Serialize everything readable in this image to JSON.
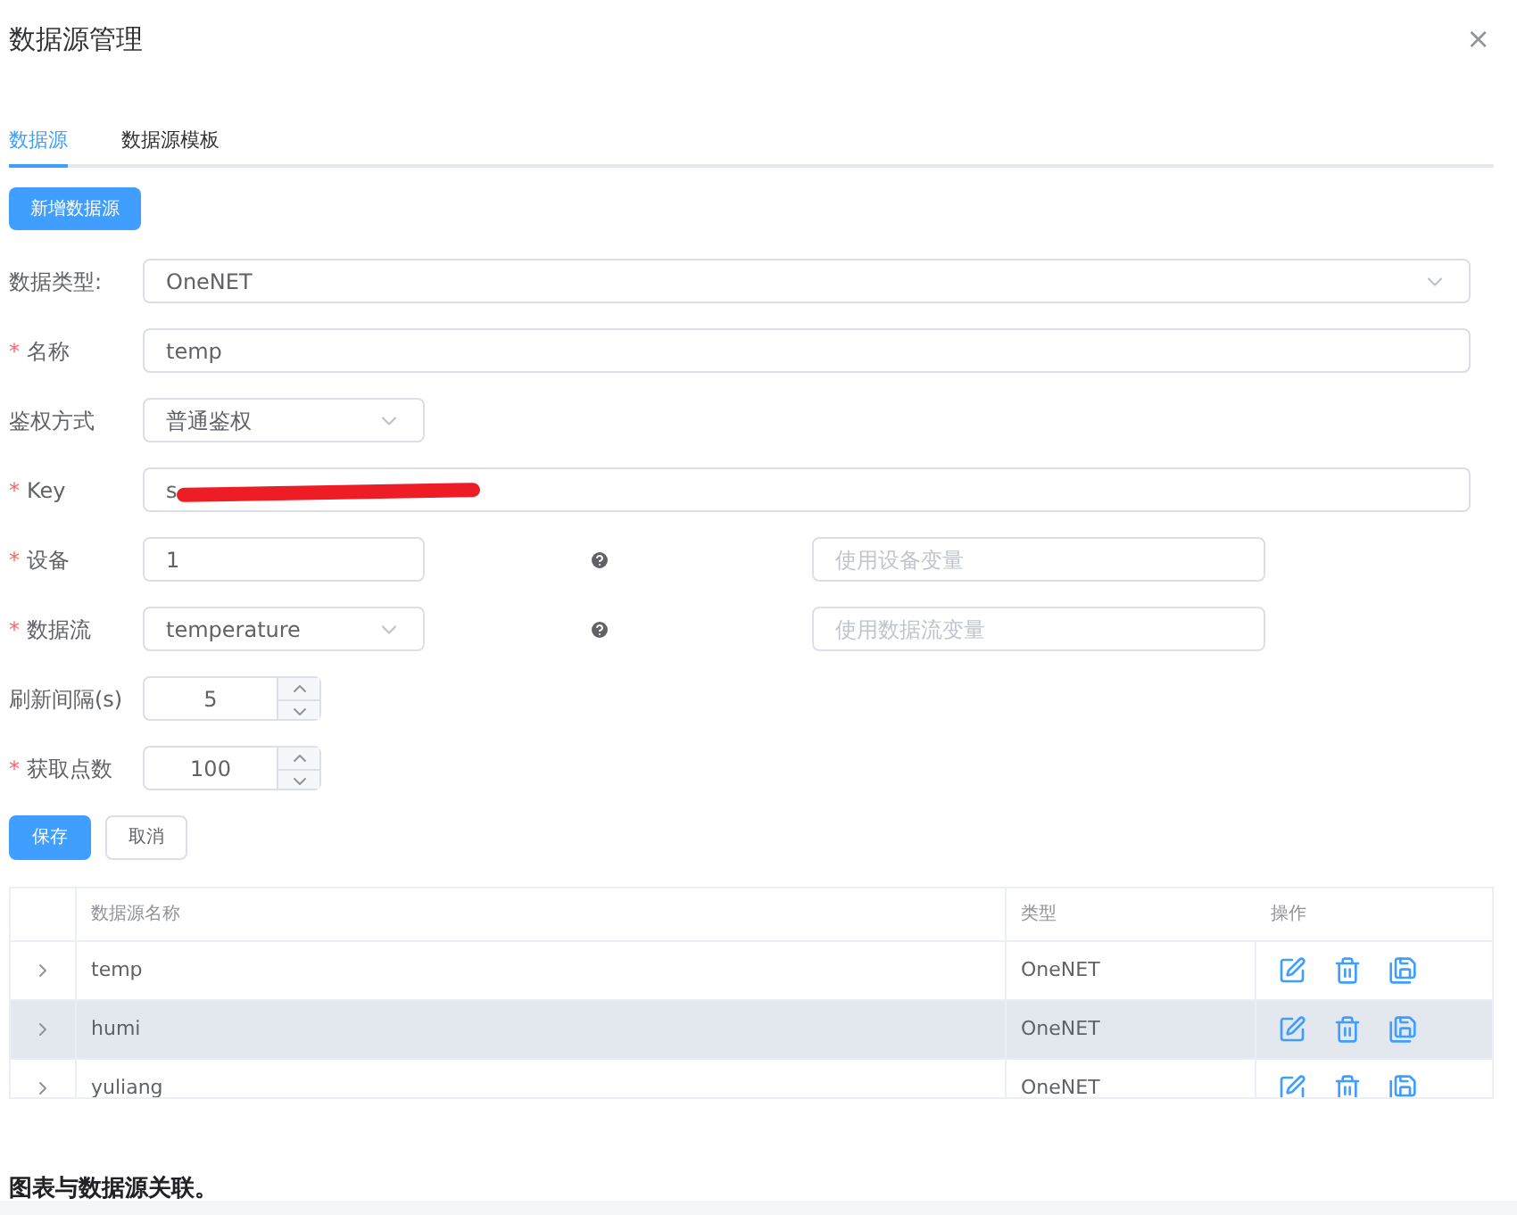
{
  "dialog": {
    "title": "数据源管理",
    "close": "×"
  },
  "tabs": [
    {
      "label": "数据源",
      "selected": true
    },
    {
      "label": "数据源模板",
      "selected": false
    }
  ],
  "add_button": "新增数据源",
  "form": [
    {
      "kind": "select",
      "label": "数据类型:",
      "value": "OneNET",
      "wide": true
    },
    {
      "kind": "input",
      "required_mark": "*",
      "label": "名称",
      "value": "temp",
      "wide": true
    },
    {
      "kind": "select",
      "label": "鉴权方式",
      "value": "普通鉴权",
      "wide": false
    },
    {
      "kind": "input",
      "required_mark": "*",
      "label": "Key",
      "value": "s",
      "wide": true,
      "redacted": true
    },
    {
      "kind": "input",
      "required_mark": "*",
      "label": "设备",
      "value": "1",
      "wide": false,
      "variable_placeholder": "使用设备变量"
    },
    {
      "kind": "select",
      "required_mark": "*",
      "label": "数据流",
      "value": "temperature",
      "wide": false,
      "variable_placeholder": "使用数据流变量"
    },
    {
      "kind": "number",
      "label": "刷新间隔(s)",
      "value": "5"
    },
    {
      "kind": "number",
      "required_mark": "*",
      "label": "获取点数",
      "value": "100"
    }
  ],
  "buttons": [
    {
      "label": "保存",
      "primary": true
    },
    {
      "label": "取消",
      "primary": false
    }
  ],
  "table": {
    "columns": [
      "数据源名称",
      "类型",
      "操作"
    ],
    "rows": [
      {
        "name": "temp",
        "type": "OneNET",
        "striped": false
      },
      {
        "name": "humi",
        "type": "OneNET",
        "striped": true
      },
      {
        "name": "yuliang",
        "type": "OneNET",
        "striped": false
      }
    ]
  },
  "caption": "图表与数据源关联。"
}
